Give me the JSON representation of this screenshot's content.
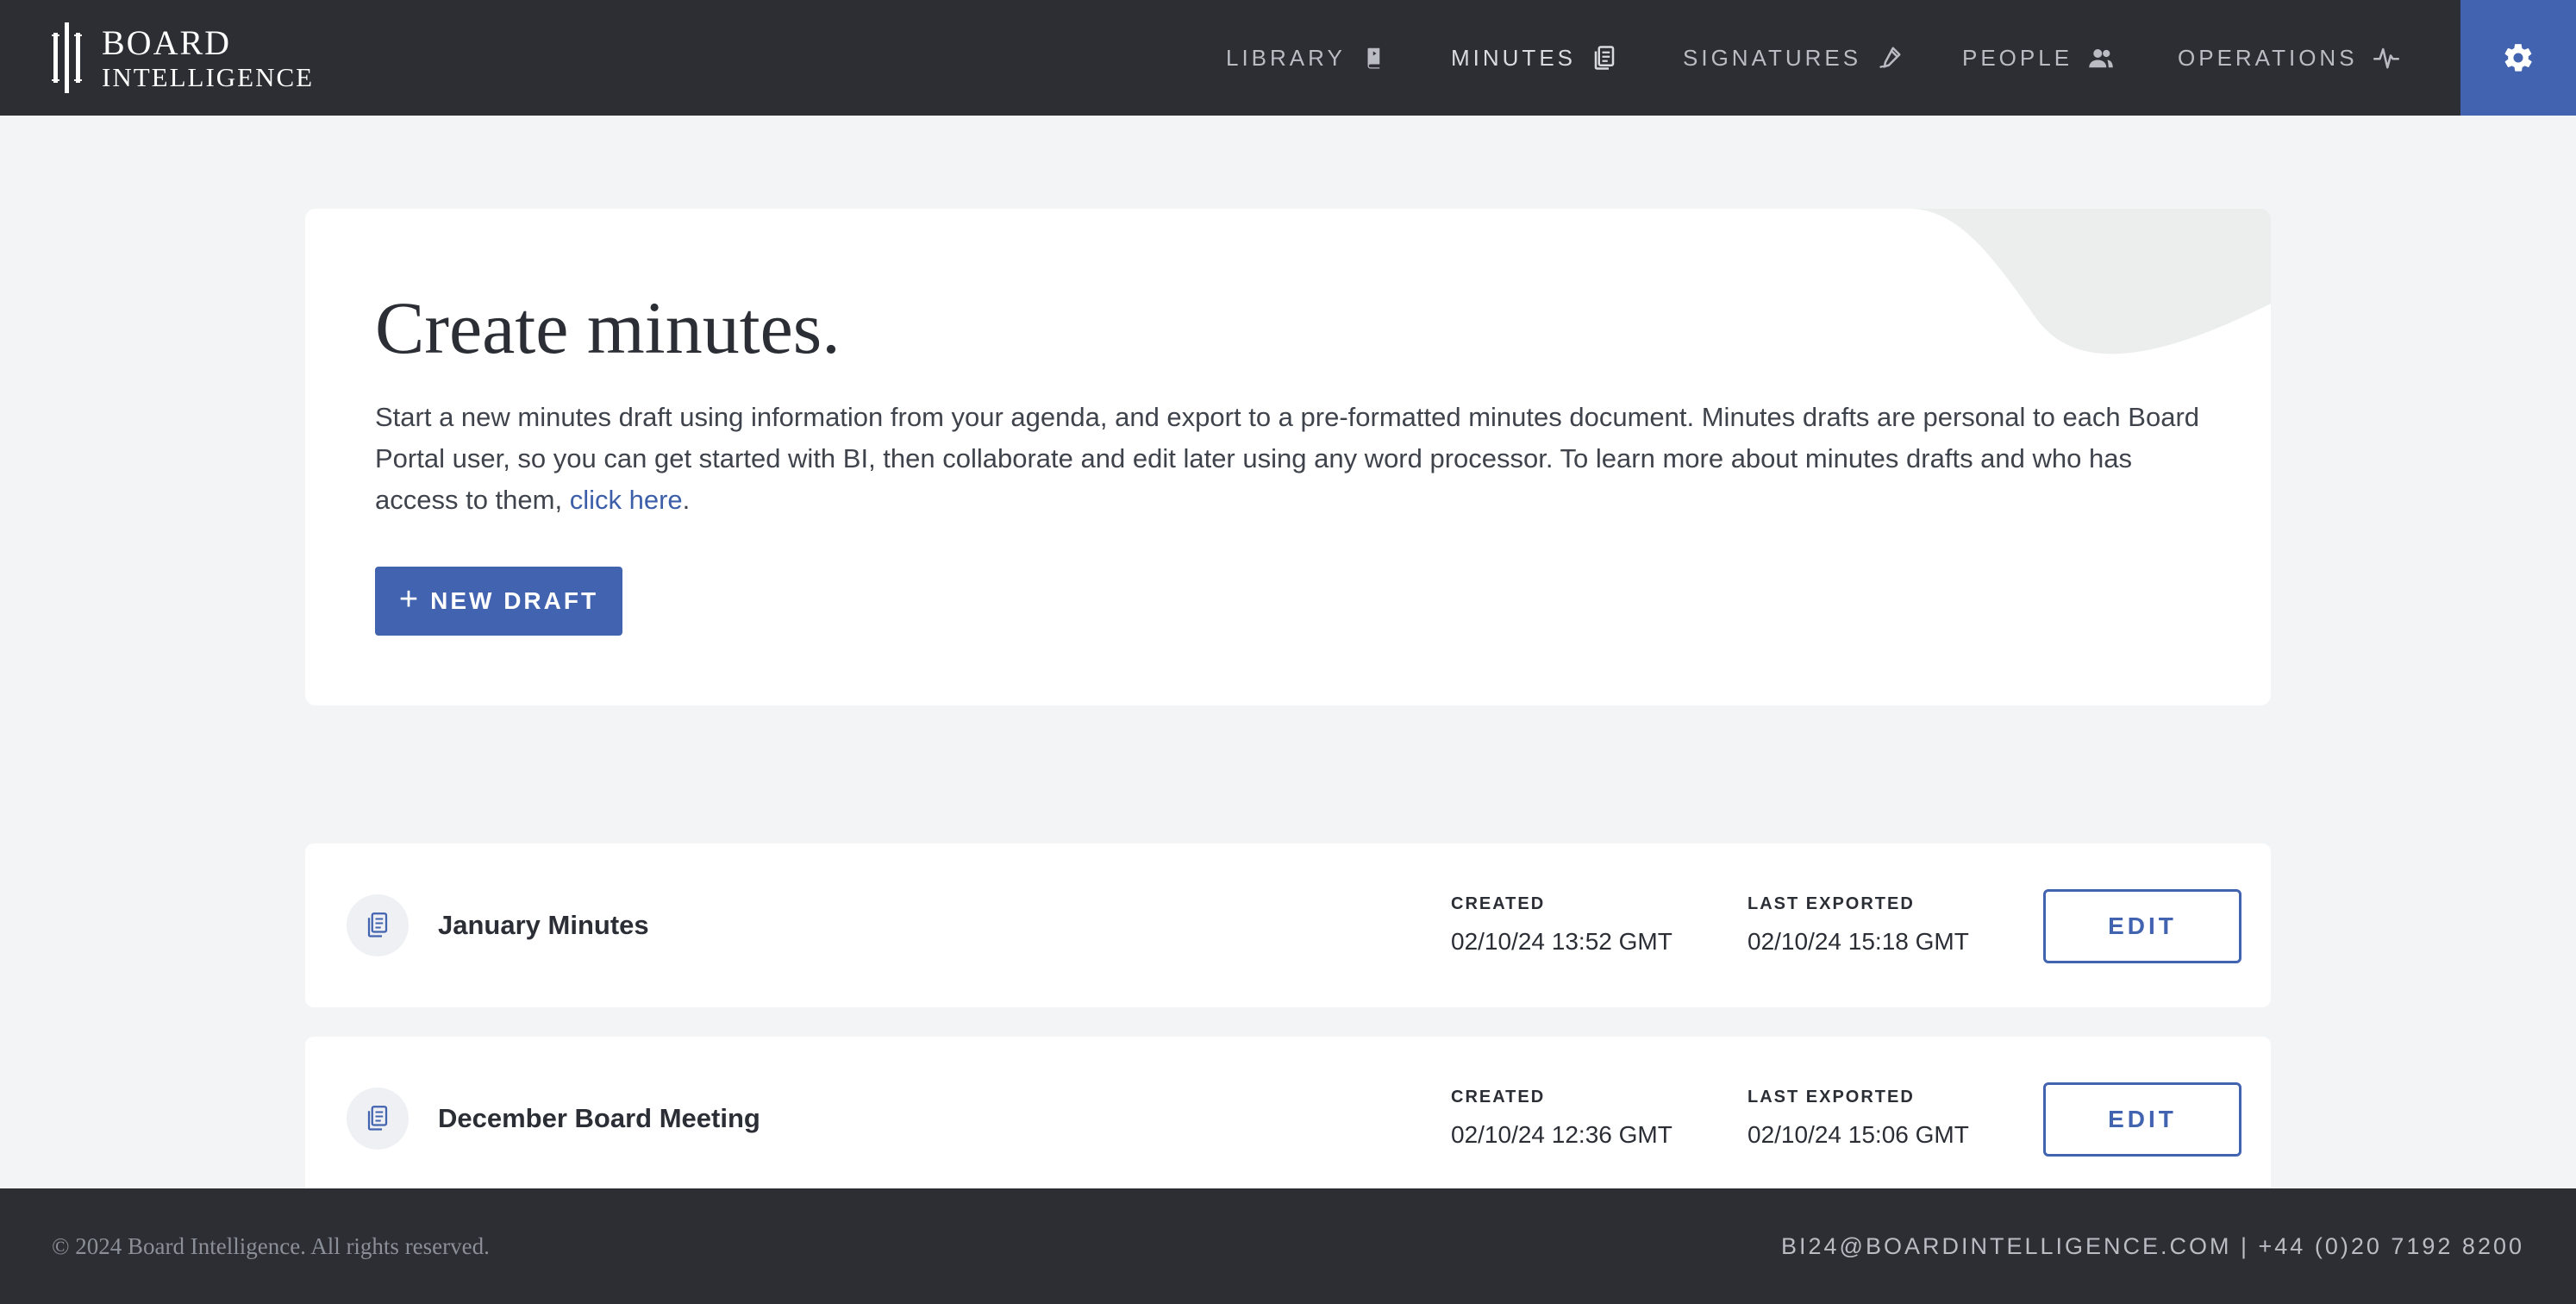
{
  "header": {
    "logo_line1": "BOARD",
    "logo_line2": "INTELLIGENCE",
    "nav": [
      {
        "label": "LIBRARY",
        "icon": "book-icon"
      },
      {
        "label": "MINUTES",
        "icon": "document-icon"
      },
      {
        "label": "SIGNATURES",
        "icon": "pen-icon"
      },
      {
        "label": "PEOPLE",
        "icon": "people-icon"
      },
      {
        "label": "OPERATIONS",
        "icon": "pulse-icon"
      }
    ],
    "settings_icon": "gear-icon"
  },
  "create": {
    "title": "Create minutes.",
    "description": "Start a new minutes draft using information from your agenda, and export to a pre-formatted minutes document. Minutes drafts are personal to each Board Portal user, so you can get started with BI, then collaborate and edit later using any word processor. To learn more about minutes drafts and who has access to them, ",
    "link_text": "click here",
    "description_end": ".",
    "button_label": "NEW DRAFT"
  },
  "drafts": [
    {
      "title": "January Minutes",
      "created_label": "CREATED",
      "created_value": "02/10/24 13:52 GMT",
      "exported_label": "LAST EXPORTED",
      "exported_value": "02/10/24 15:18 GMT",
      "edit_label": "EDIT"
    },
    {
      "title": "December Board Meeting",
      "created_label": "CREATED",
      "created_value": "02/10/24 12:36 GMT",
      "exported_label": "LAST EXPORTED",
      "exported_value": "02/10/24 15:06 GMT",
      "edit_label": "EDIT"
    }
  ],
  "footer": {
    "copyright": "© 2024 Board Intelligence. All rights reserved.",
    "contact": "BI24@BOARDINTELLIGENCE.COM | +44 (0)20 7192 8200"
  },
  "colors": {
    "header_bg": "#2c2e33",
    "accent": "#4263b0",
    "page_bg": "#f3f4f6",
    "link": "#3d5fa9"
  }
}
